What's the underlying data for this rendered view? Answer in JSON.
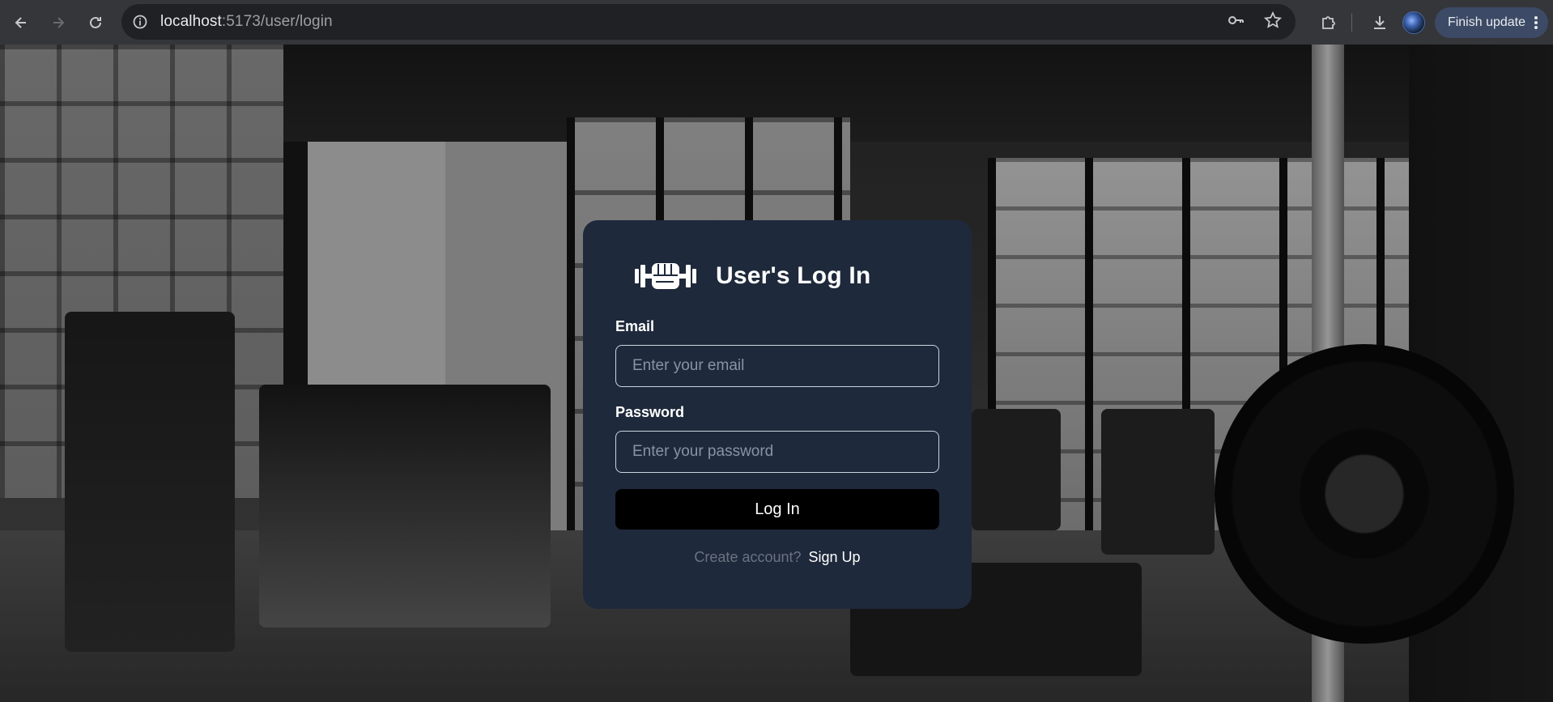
{
  "browser": {
    "url_host": "localhost",
    "url_path": ":5173/user/login",
    "update_label": "Finish update"
  },
  "login": {
    "title": "User's Log In",
    "email_label": "Email",
    "email_placeholder": "Enter your email",
    "password_label": "Password",
    "password_placeholder": "Enter your password",
    "submit_label": "Log In",
    "signup_prompt": "Create account?",
    "signup_link": "Sign Up"
  },
  "colors": {
    "card_bg": "#1e293b",
    "button_bg": "#000000",
    "input_border": "#cbd5e1"
  }
}
